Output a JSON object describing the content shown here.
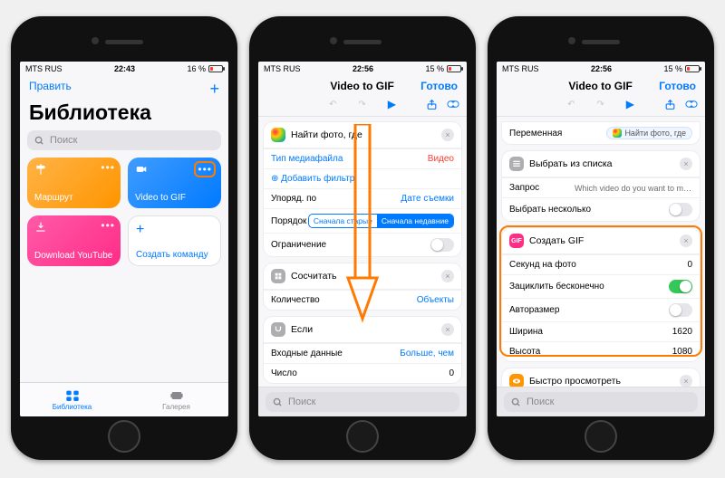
{
  "status": {
    "carrier": "MTS RUS",
    "t1": "22:43",
    "t2": "22:56",
    "t3": "22:56",
    "b1": "16 %",
    "b2": "15 %",
    "b3": "15 %"
  },
  "s1": {
    "edit": "Править",
    "title": "Библиотека",
    "search_ph": "Поиск",
    "tiles": {
      "route": "Маршрут",
      "vgif": "Video to GIF",
      "dly": "Download YouTube",
      "create": "Создать команду"
    },
    "tabs": {
      "lib": "Библиотека",
      "gal": "Галерея"
    }
  },
  "s2": {
    "title": "Video to GIF",
    "done": "Готово",
    "find_photo": "Найти фото, где",
    "media_type": "Тип медиафайла",
    "media_val": "Видео",
    "add_filter": "Добавить фильтр",
    "sort_by": "Упоряд. по",
    "sort_by_val": "Дате съемки",
    "order": "Порядок",
    "order_old": "Сначала старые",
    "order_new": "Сначала недавние",
    "limit": "Ограничение",
    "count_hdr": "Сосчитать",
    "count_lbl": "Количество",
    "count_val": "Объекты",
    "if_hdr": "Если",
    "input_lbl": "Входные данные",
    "input_val": "Больше, чем",
    "num_lbl": "Число",
    "num_val": "0",
    "search_ph": "Поиск"
  },
  "s3": {
    "title": "Video to GIF",
    "done": "Готово",
    "var_lbl": "Переменная",
    "var_pill": "Найти фото, где",
    "choose_hdr": "Выбрать из списка",
    "prompt_lbl": "Запрос",
    "prompt_val": "Which video do you want to make a...",
    "multi_lbl": "Выбрать несколько",
    "gif_hdr": "Создать GIF",
    "sec_lbl": "Секунд на фото",
    "sec_val": "0",
    "loop_lbl": "Зациклить бесконечно",
    "auto_lbl": "Авторазмер",
    "w_lbl": "Ширина",
    "w_val": "1620",
    "h_lbl": "Высота",
    "h_val": "1080",
    "quick_hdr": "Быстро просмотреть",
    "search_ph": "Поиск"
  }
}
